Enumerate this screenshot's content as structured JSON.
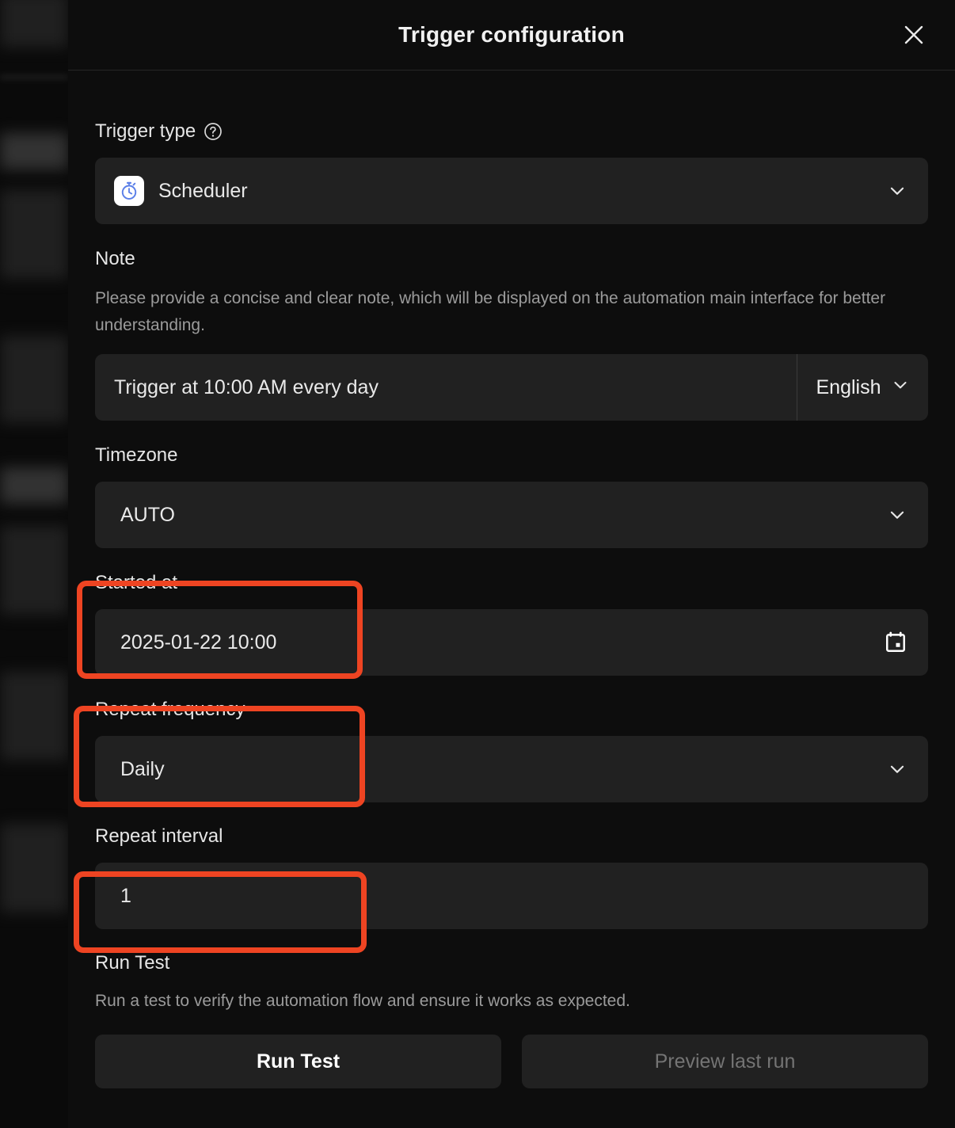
{
  "modal": {
    "title": "Trigger configuration",
    "close_icon": "close-icon"
  },
  "trigger_type": {
    "label": "Trigger type",
    "help_icon": "help-circle-icon",
    "selected": "Scheduler",
    "icon": "stopwatch-icon",
    "chevron_icon": "chevron-down-icon"
  },
  "note": {
    "label": "Note",
    "description": "Please provide a concise and clear note, which will be displayed on the automation main interface for better understanding.",
    "value": "Trigger at 10:00 AM every day",
    "placeholder": "Trigger at 10:00 AM every day",
    "language": "English",
    "language_chevron_icon": "chevron-down-icon"
  },
  "timezone": {
    "label": "Timezone",
    "value": "AUTO",
    "chevron_icon": "chevron-down-icon"
  },
  "started_at": {
    "label": "Started at",
    "value": "2025-01-22 10:00",
    "calendar_icon": "calendar-icon"
  },
  "repeat_frequency": {
    "label": "Repeat frequency",
    "value": "Daily",
    "chevron_icon": "chevron-down-icon"
  },
  "repeat_interval": {
    "label": "Repeat interval",
    "value": "1"
  },
  "run_test": {
    "label": "Run Test",
    "description": "Run a test to verify the automation flow and ensure it works as expected.",
    "run_button": "Run Test",
    "preview_button": "Preview last run"
  },
  "annotations": {
    "highlight_color": "#ee4422",
    "boxes": [
      {
        "name": "started-at-highlight"
      },
      {
        "name": "repeat-frequency-highlight"
      },
      {
        "name": "repeat-interval-highlight"
      }
    ]
  }
}
